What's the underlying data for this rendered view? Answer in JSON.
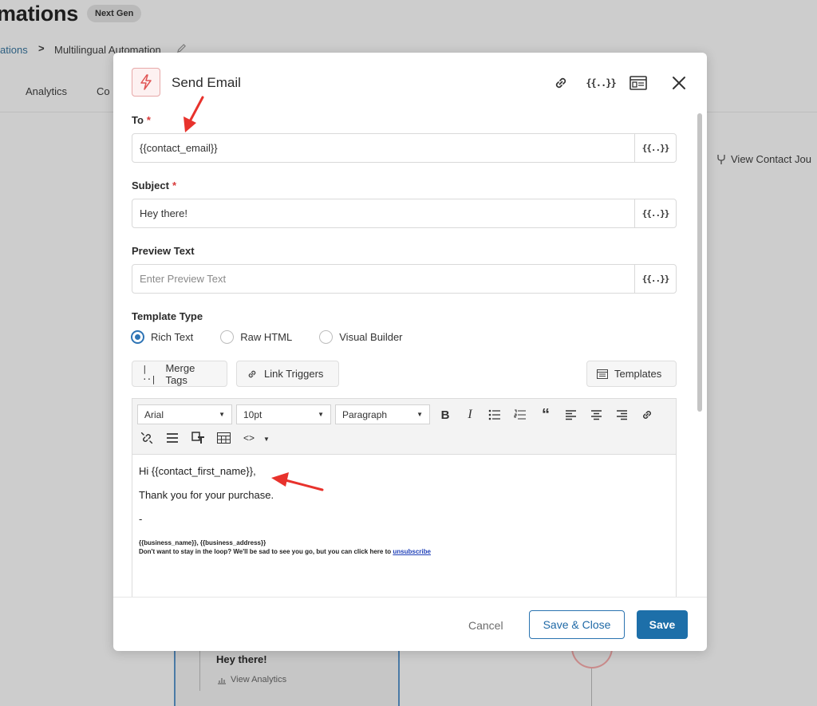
{
  "background": {
    "title": "mations",
    "badge": "Next Gen",
    "breadcrumb": {
      "parent": "ations",
      "separator": ">",
      "current": "Multilingual Automation"
    },
    "tabs": [
      "Analytics",
      "Co"
    ],
    "journey_link": "View Contact Jou",
    "card": {
      "title": "Hey there!",
      "link": "View Analytics"
    }
  },
  "modal": {
    "title": "Send Email",
    "merge_symbol": "{{..}}",
    "to": {
      "label": "To",
      "required_mark": "*",
      "value": "{{contact_email}}"
    },
    "subject": {
      "label": "Subject",
      "required_mark": "*",
      "value": "Hey there!"
    },
    "preview": {
      "label": "Preview Text",
      "placeholder": "Enter Preview Text"
    },
    "template_type": {
      "label": "Template Type",
      "options": [
        "Rich Text",
        "Raw HTML",
        "Visual Builder"
      ],
      "selected": "Rich Text"
    },
    "buttons": {
      "merge_tags": "Merge Tags",
      "link_triggers": "Link Triggers",
      "templates": "Templates"
    },
    "editor": {
      "font": "Arial",
      "size": "10pt",
      "block": "Paragraph",
      "body": {
        "greeting": "Hi {{contact_first_name}},",
        "thanks": "Thank you for your purchase.",
        "dash": "-",
        "business": "{{business_name}}, {{business_address}}",
        "unsub_text": "Don't want to stay in the loop? We'll be sad to see you go, but you can click here to ",
        "unsub_link": "unsubscribe"
      }
    },
    "footer": {
      "cancel": "Cancel",
      "save_close": "Save & Close",
      "save": "Save"
    }
  },
  "colors": {
    "primary": "#1d6fa9",
    "required": "#d83a3a",
    "accent_icon": "#e05555",
    "annotation_arrow": "#e8322c"
  }
}
